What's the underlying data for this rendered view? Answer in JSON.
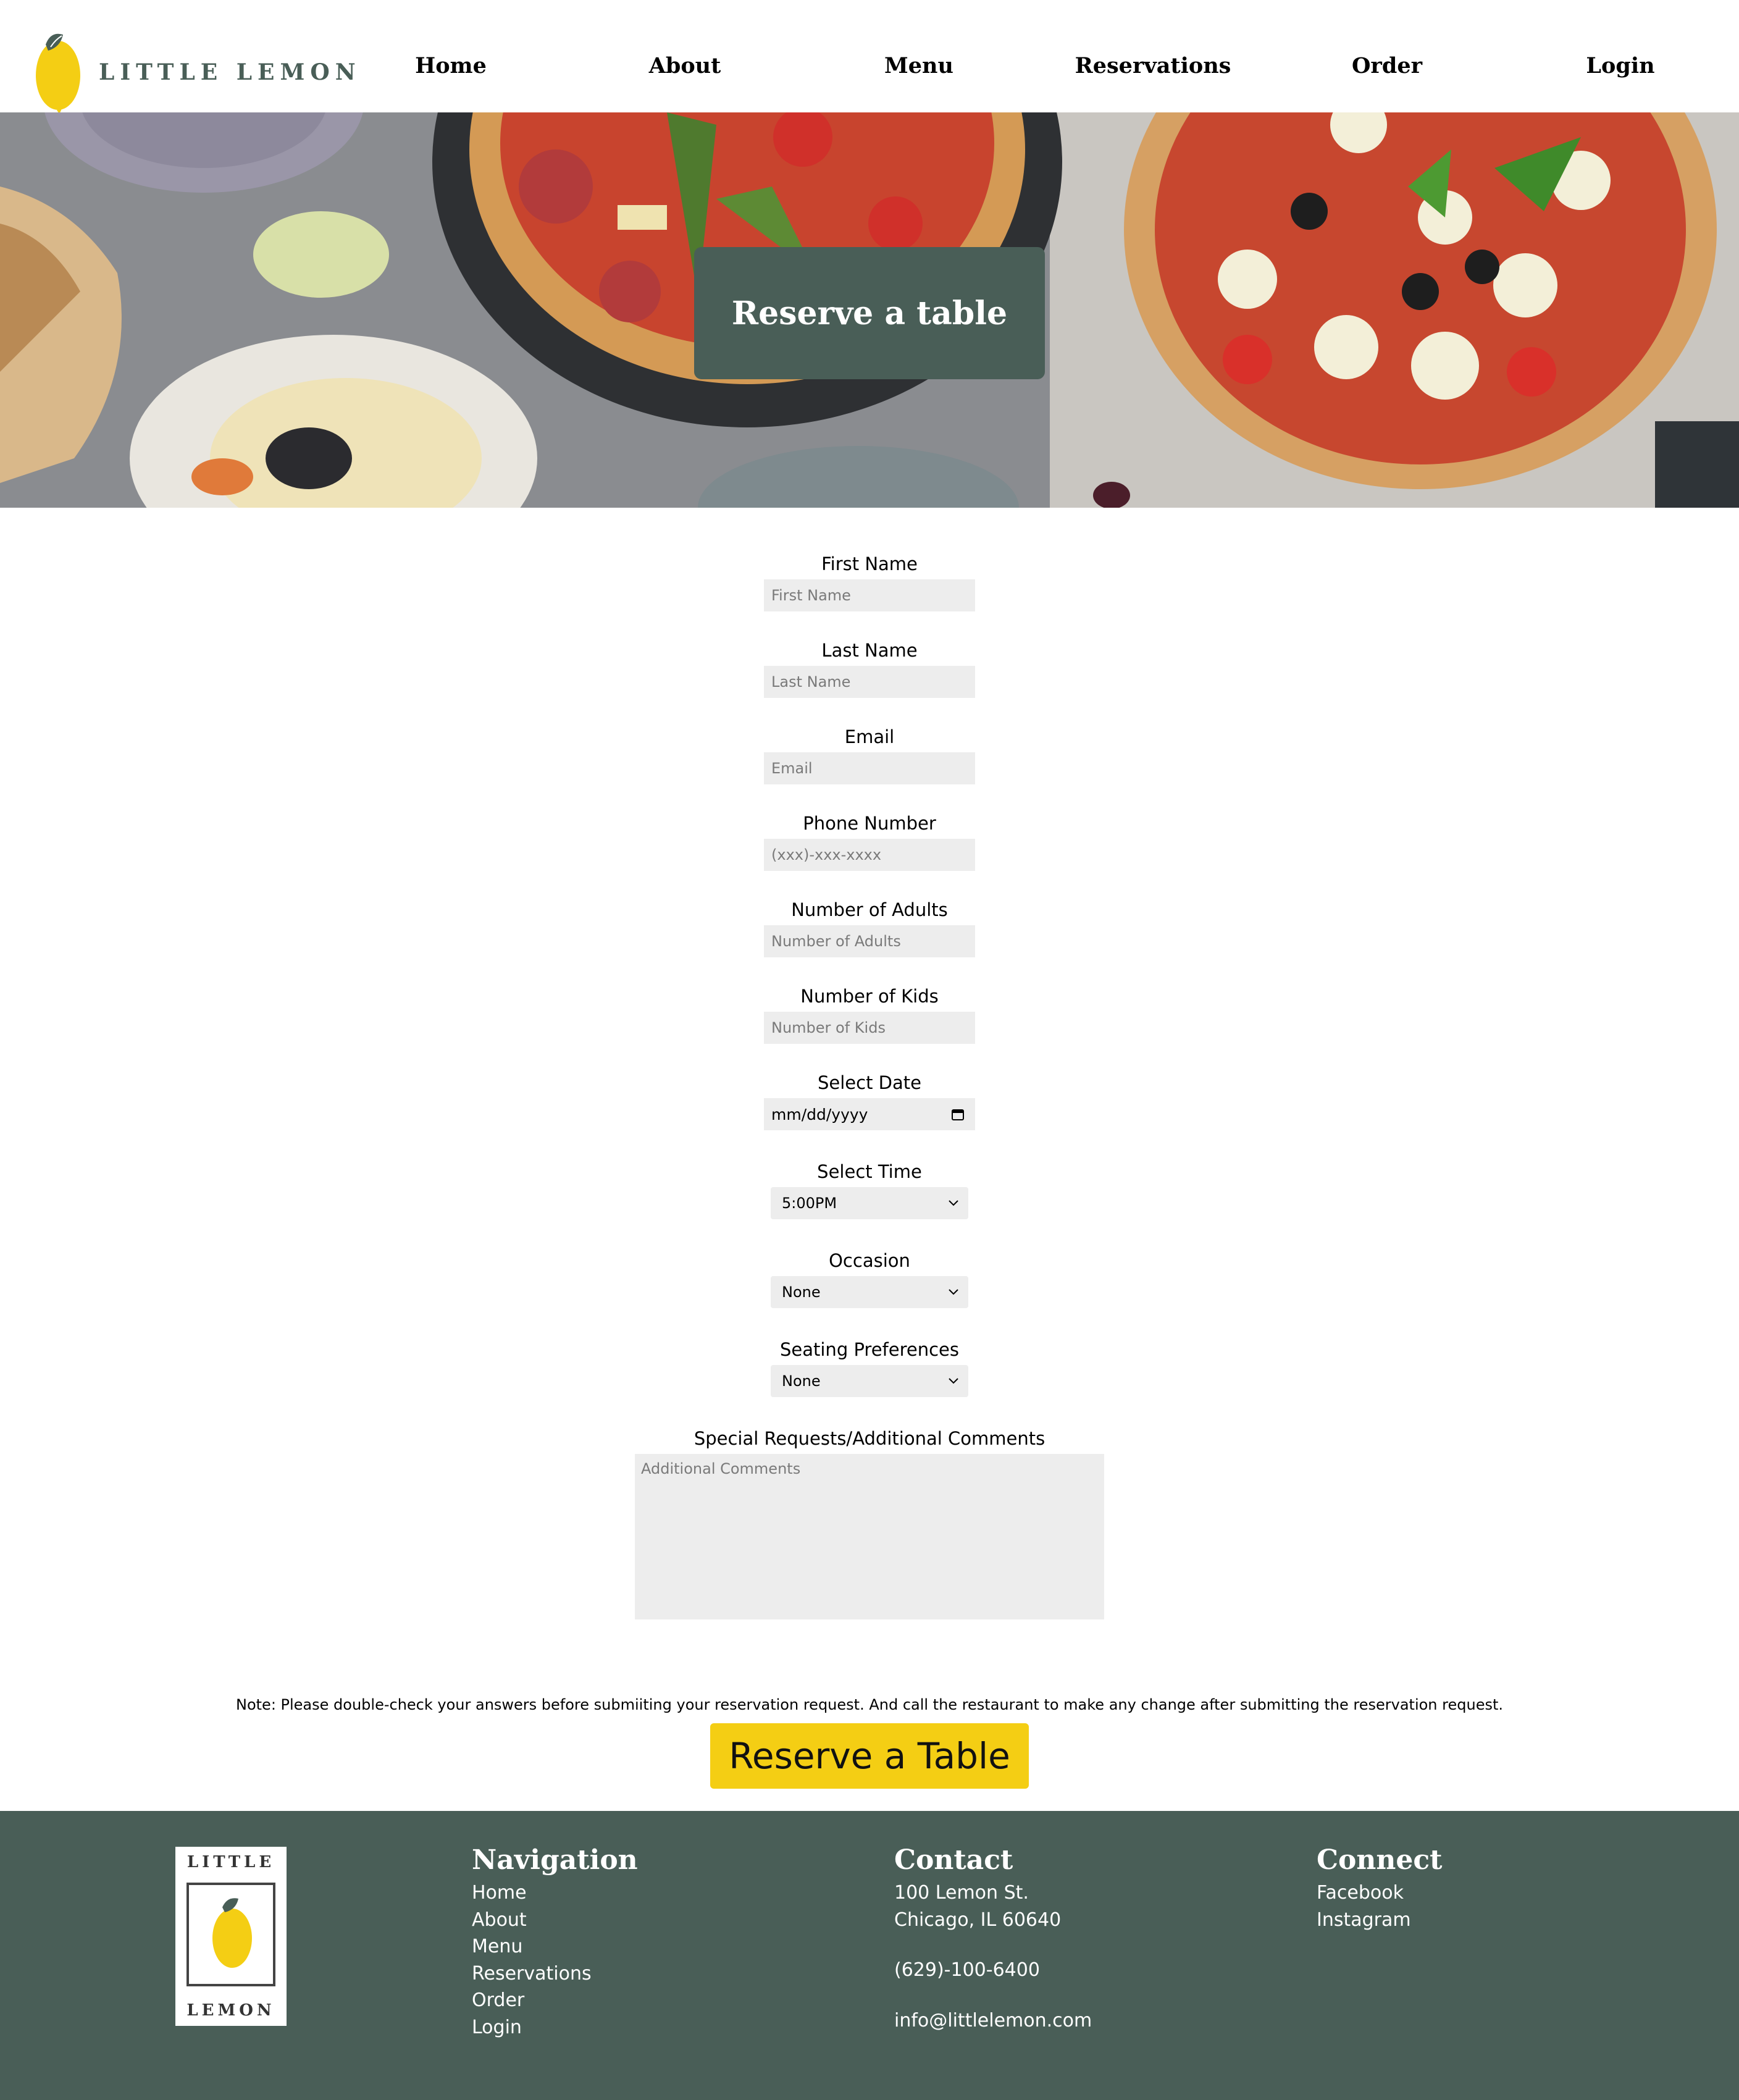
{
  "brand": {
    "name": "LITTLE LEMON",
    "footer_top": "LITTLE",
    "footer_bottom": "LEMON",
    "accent": "#F4CE14",
    "primary": "#495E57"
  },
  "nav": [
    "Home",
    "About",
    "Menu",
    "Reservations",
    "Order",
    "Login"
  ],
  "hero": {
    "title": "Reserve a table"
  },
  "form": {
    "first_name": {
      "label": "First Name",
      "placeholder": "First Name"
    },
    "last_name": {
      "label": "Last Name",
      "placeholder": "Last Name"
    },
    "email": {
      "label": "Email",
      "placeholder": "Email"
    },
    "phone": {
      "label": "Phone Number",
      "placeholder": "(xxx)-xxx-xxxx"
    },
    "adults": {
      "label": "Number of Adults",
      "placeholder": "Number of Adults"
    },
    "kids": {
      "label": "Number of Kids",
      "placeholder": "Number of Kids"
    },
    "date": {
      "label": "Select Date",
      "value": "mm/dd/yyyy"
    },
    "time": {
      "label": "Select Time",
      "value": "5:00PM"
    },
    "occasion": {
      "label": "Occasion",
      "value": "None"
    },
    "seating": {
      "label": "Seating Preferences",
      "value": "None"
    },
    "comments": {
      "label": "Special Requests/Additional Comments",
      "placeholder": "Additional Comments"
    },
    "note": "Note: Please double-check your answers before submiiting your reservation request. And call the restaurant to make any change after submitting the reservation request.",
    "submit": "Reserve a Table"
  },
  "footer": {
    "navigation": {
      "title": "Navigation",
      "links": [
        "Home",
        "About",
        "Menu",
        "Reservations",
        "Order",
        "Login"
      ]
    },
    "contact": {
      "title": "Contact",
      "address1": "100 Lemon St.",
      "address2": "Chicago, IL 60640",
      "phone": "(629)-100-6400",
      "email": "info@littlelemon.com"
    },
    "connect": {
      "title": "Connect",
      "links": [
        "Facebook",
        "Instagram"
      ]
    }
  }
}
